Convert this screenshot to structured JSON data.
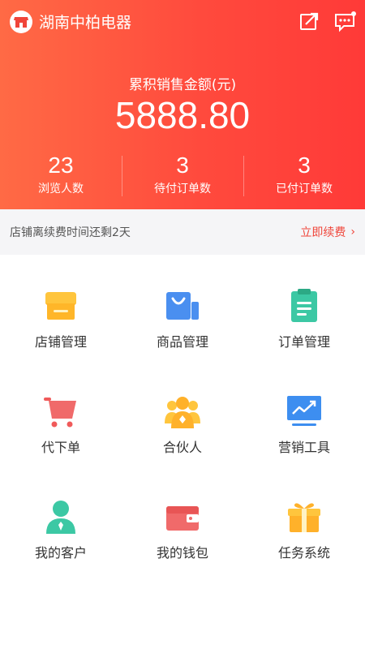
{
  "header": {
    "store_name": "湖南中柏电器",
    "total_sales_label": "累积销售金额(元)",
    "total_sales_value": "5888.80",
    "icons": {
      "edit": "edit-share-icon",
      "message": "message-icon"
    }
  },
  "stats": [
    {
      "value": "23",
      "label": "浏览人数"
    },
    {
      "value": "3",
      "label": "待付订单数"
    },
    {
      "value": "3",
      "label": "已付订单数"
    }
  ],
  "renew": {
    "text": "店铺离续费时间还剩2天",
    "link": "立即续费"
  },
  "menu": [
    {
      "label": "店铺管理",
      "icon": "store-icon"
    },
    {
      "label": "商品管理",
      "icon": "shopping-bag-icon"
    },
    {
      "label": "订单管理",
      "icon": "clipboard-icon"
    },
    {
      "label": "代下单",
      "icon": "cart-icon"
    },
    {
      "label": "合伙人",
      "icon": "partners-icon"
    },
    {
      "label": "营销工具",
      "icon": "monitor-chart-icon"
    },
    {
      "label": "我的客户",
      "icon": "customer-icon"
    },
    {
      "label": "我的钱包",
      "icon": "wallet-icon"
    },
    {
      "label": "任务系统",
      "icon": "gift-icon"
    }
  ],
  "colors": {
    "header_start": "#ff6a45",
    "header_end": "#ff3a38",
    "accent": "#f0453a",
    "renew_bg": "#f5f5f7"
  }
}
